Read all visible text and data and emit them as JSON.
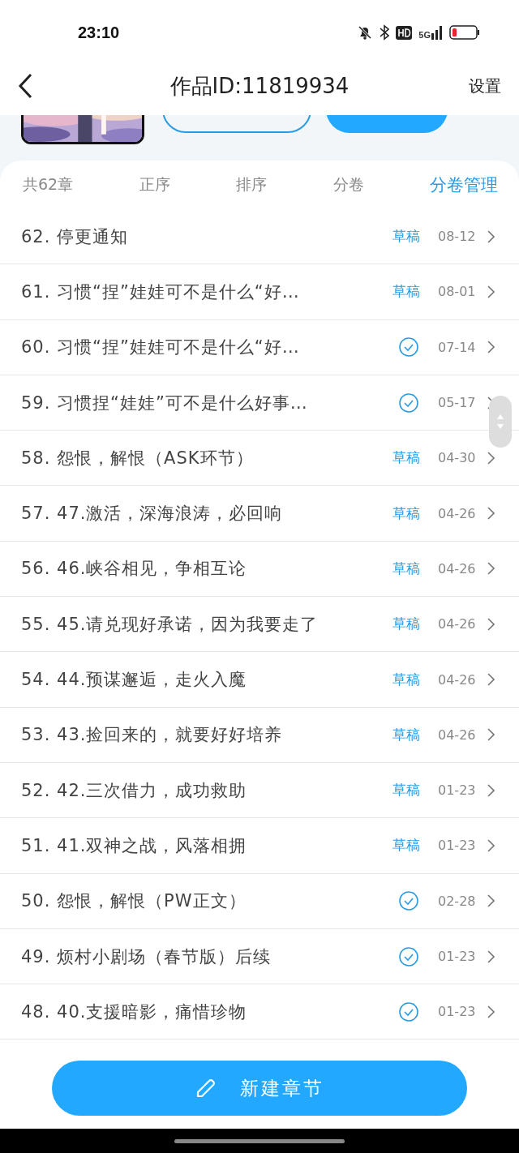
{
  "status_bar": {
    "time": "23:10",
    "network": "5G"
  },
  "header": {
    "title": "作品ID:11819934",
    "action": "设置"
  },
  "toolbar": [
    {
      "label": "共62章",
      "kind": "count"
    },
    {
      "label": "正序",
      "kind": "option"
    },
    {
      "label": "排序",
      "kind": "option"
    },
    {
      "label": "分卷",
      "kind": "option"
    },
    {
      "label": "分卷管理",
      "kind": "action"
    }
  ],
  "chapters": [
    {
      "title": "62. 停更通知",
      "kind": "draft",
      "status_label": "草稿",
      "date": "08-12"
    },
    {
      "title": "61. 习惯“捏”娃娃可不是什么“好…",
      "kind": "draft",
      "status_label": "草稿",
      "date": "08-01"
    },
    {
      "title": "60. 习惯“捏”娃娃可不是什么“好…",
      "kind": "published",
      "date": "07-14"
    },
    {
      "title": "59. 习惯捏“娃娃”可不是什么好事…",
      "kind": "published",
      "date": "05-17"
    },
    {
      "title": "58. 怨恨，解恨（ASK环节）",
      "kind": "draft",
      "status_label": "草稿",
      "date": "04-30"
    },
    {
      "title": "57. 47.激活，深海浪涛，必回响",
      "kind": "draft",
      "status_label": "草稿",
      "date": "04-26"
    },
    {
      "title": "56. 46.峡谷相见，争相互论",
      "kind": "draft",
      "status_label": "草稿",
      "date": "04-26"
    },
    {
      "title": "55. 45.请兑现好承诺，因为我要走了",
      "kind": "draft",
      "status_label": "草稿",
      "date": "04-26"
    },
    {
      "title": "54. 44.预谋邂逅，走火入魔",
      "kind": "draft",
      "status_label": "草稿",
      "date": "04-26"
    },
    {
      "title": "53. 43.捡回来的，就要好好培养",
      "kind": "draft",
      "status_label": "草稿",
      "date": "04-26"
    },
    {
      "title": "52. 42.三次借力，成功救助",
      "kind": "draft",
      "status_label": "草稿",
      "date": "01-23"
    },
    {
      "title": "51. 41.双神之战，风落相拥",
      "kind": "draft",
      "status_label": "草稿",
      "date": "01-23"
    },
    {
      "title": "50. 怨恨，解恨（PW正文）",
      "kind": "published",
      "date": "02-28"
    },
    {
      "title": "49. 烦村小剧场（春节版）后续",
      "kind": "published",
      "date": "01-23"
    },
    {
      "title": "48. 40.支援暗影，痛惜珍物",
      "kind": "published",
      "date": "01-23"
    }
  ],
  "new_button": {
    "label": "新建章节"
  }
}
